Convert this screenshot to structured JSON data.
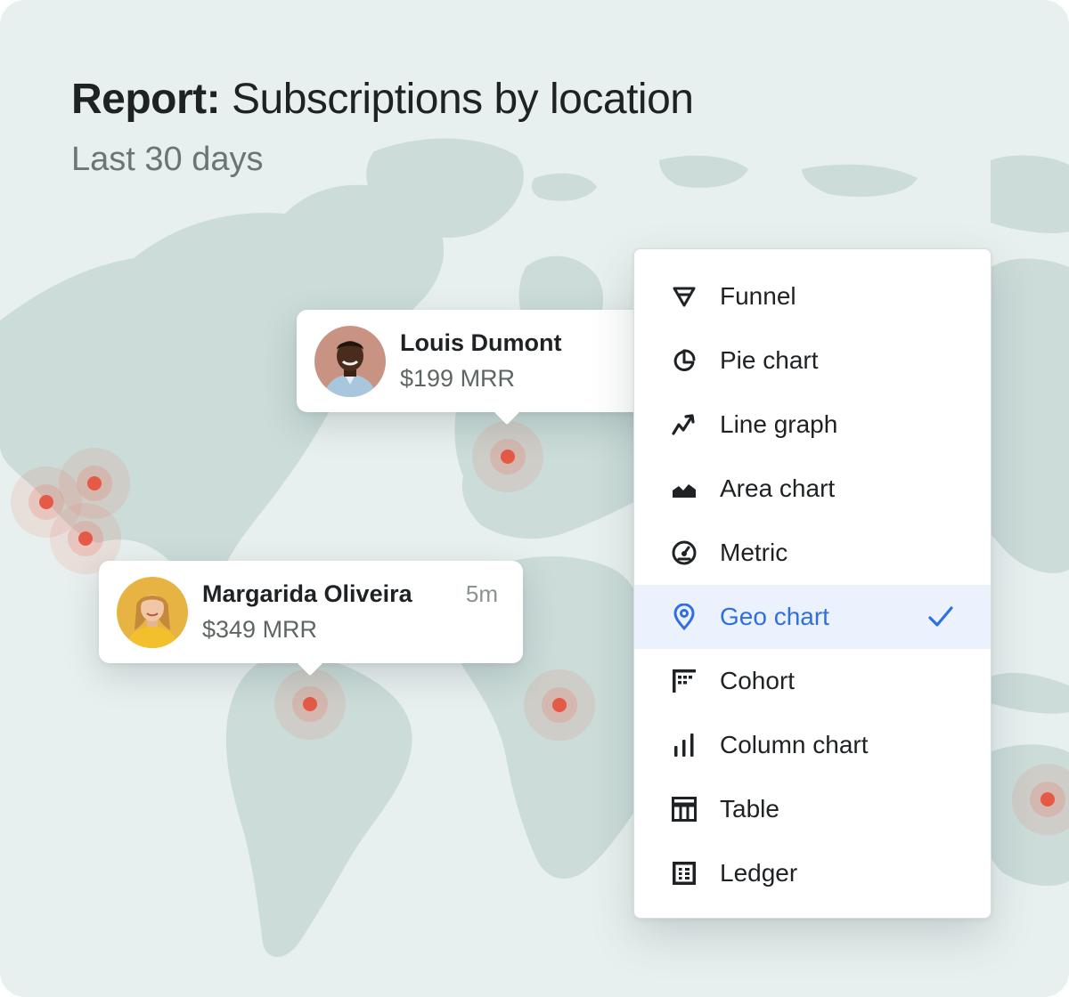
{
  "header": {
    "title_prefix": "Report:",
    "title_text": "Subscriptions by location",
    "subtitle": "Last 30 days"
  },
  "popups": [
    {
      "name": "Louis Dumont",
      "amount": "$199 MRR",
      "time": ""
    },
    {
      "name": "Margarida Oliveira",
      "amount": "$349 MRR",
      "time": "5m"
    }
  ],
  "menu": {
    "items": [
      {
        "label": "Funnel",
        "icon": "funnel-icon",
        "selected": false
      },
      {
        "label": "Pie chart",
        "icon": "pie-chart-icon",
        "selected": false
      },
      {
        "label": "Line graph",
        "icon": "line-graph-icon",
        "selected": false
      },
      {
        "label": "Area chart",
        "icon": "area-chart-icon",
        "selected": false
      },
      {
        "label": "Metric",
        "icon": "gauge-icon",
        "selected": false
      },
      {
        "label": "Geo chart",
        "icon": "map-pin-icon",
        "selected": true
      },
      {
        "label": "Cohort",
        "icon": "cohort-icon",
        "selected": false
      },
      {
        "label": "Column chart",
        "icon": "column-chart-icon",
        "selected": false
      },
      {
        "label": "Table",
        "icon": "table-icon",
        "selected": false
      },
      {
        "label": "Ledger",
        "icon": "ledger-icon",
        "selected": false
      }
    ]
  },
  "colors": {
    "accent": "#2f6fe0",
    "marker": "#e45a46",
    "map_land": "#c9dbd8",
    "background": "#e8f0ef"
  }
}
